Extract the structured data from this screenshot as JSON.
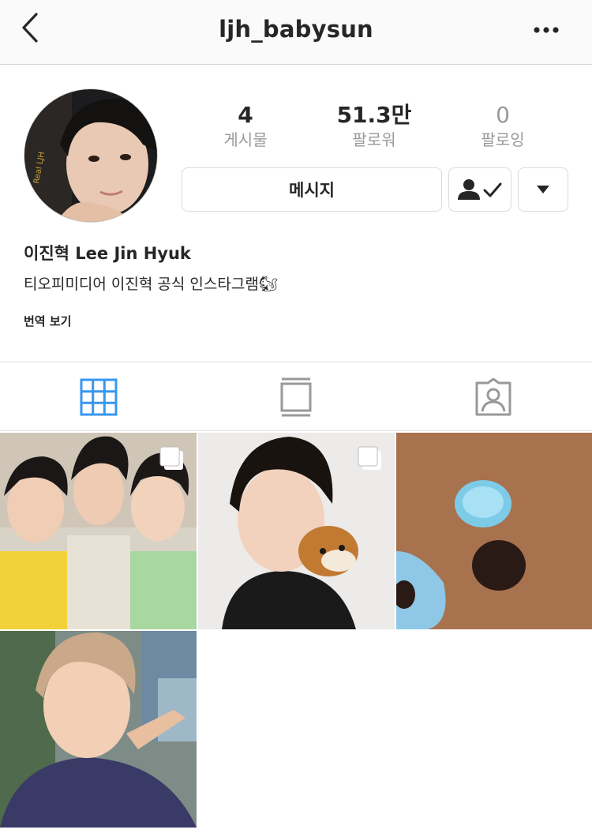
{
  "nav": {
    "title": "ljh_babysun",
    "back_icon": "chevron-left-icon",
    "more_icon": "more-horizontal-icon"
  },
  "stats": [
    {
      "value": "4",
      "label": "게시물"
    },
    {
      "value": "51.3만",
      "label": "팔로워"
    },
    {
      "value": "0",
      "label": "팔로잉"
    }
  ],
  "actions": {
    "message_label": "메시지",
    "following_icon": "person-check-icon",
    "dropdown_icon": "caret-down-icon"
  },
  "profile": {
    "name": "이진혁 Lee Jin Hyuk",
    "bio": "티오피미디어 이진혁 공식 인스타그램🐿",
    "translate": "번역 보기",
    "avatar_text": "Real LJH"
  },
  "tabs": [
    {
      "icon": "grid-icon",
      "active": true
    },
    {
      "icon": "feed-list-icon",
      "active": false
    },
    {
      "icon": "tagged-person-icon",
      "active": false
    }
  ],
  "colors": {
    "active_tab": "#3897f0",
    "inactive_tab": "#999999",
    "border": "#dbdbdb",
    "text": "#262626"
  }
}
